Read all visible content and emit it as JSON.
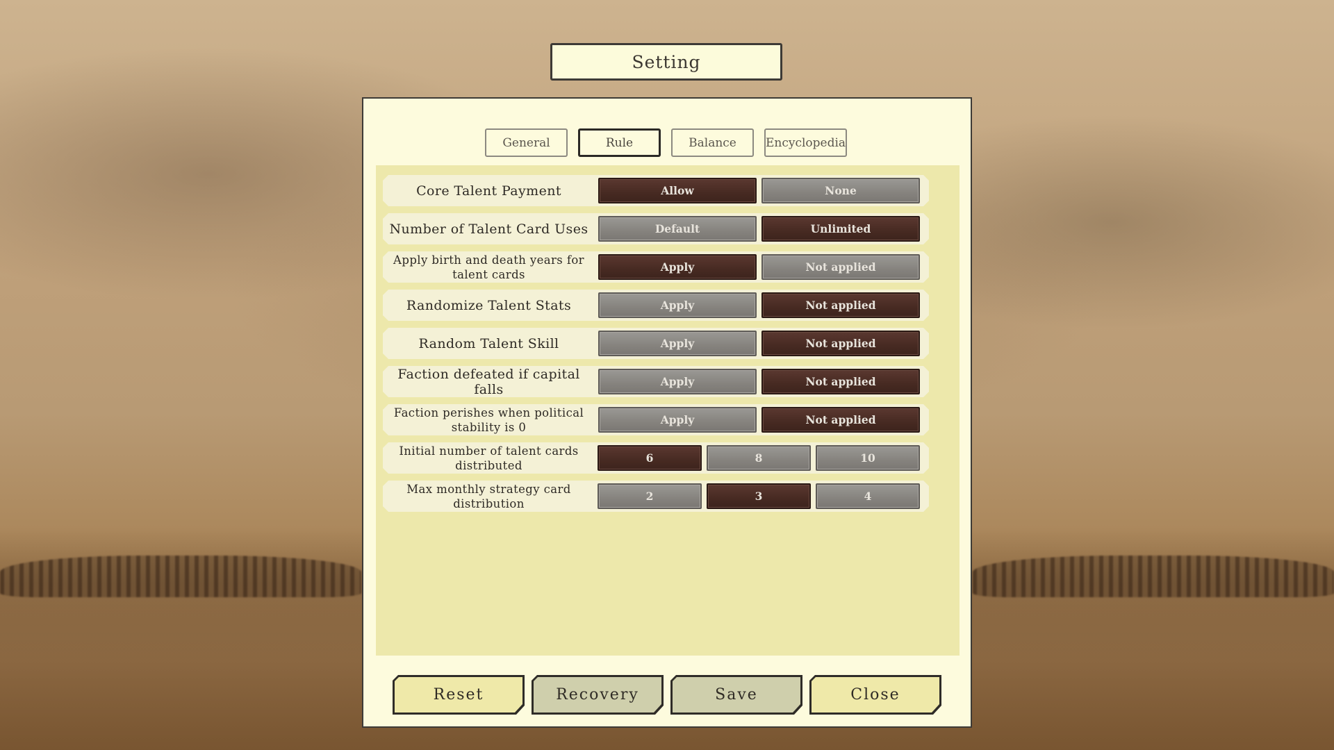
{
  "title": "Setting",
  "tabs": [
    {
      "label": "General",
      "active": false
    },
    {
      "label": "Rule",
      "active": true
    },
    {
      "label": "Balance",
      "active": false
    },
    {
      "label": "Encyclopedia",
      "active": false
    }
  ],
  "rules": [
    {
      "label": "Core Talent Payment",
      "options": [
        "Allow",
        "None"
      ],
      "selected": 0
    },
    {
      "label": "Number of Talent Card Uses",
      "options": [
        "Default",
        "Unlimited"
      ],
      "selected": 1
    },
    {
      "label": "Apply birth and death years for talent cards",
      "options": [
        "Apply",
        "Not applied"
      ],
      "selected": 0
    },
    {
      "label": "Randomize Talent Stats",
      "options": [
        "Apply",
        "Not applied"
      ],
      "selected": 1
    },
    {
      "label": "Random Talent Skill",
      "options": [
        "Apply",
        "Not applied"
      ],
      "selected": 1
    },
    {
      "label": "Faction defeated if capital falls",
      "options": [
        "Apply",
        "Not applied"
      ],
      "selected": 1
    },
    {
      "label": "Faction perishes when political stability is 0",
      "options": [
        "Apply",
        "Not applied"
      ],
      "selected": 1
    },
    {
      "label": "Initial number of talent cards distributed",
      "options": [
        "6",
        "8",
        "10"
      ],
      "selected": 0
    },
    {
      "label": "Max monthly strategy card distribution",
      "options": [
        "2",
        "3",
        "4"
      ],
      "selected": 1
    }
  ],
  "footer": {
    "reset_label": "Reset",
    "recovery_label": "Recovery",
    "save_label": "Save",
    "close_label": "Close"
  },
  "colors": {
    "selected": "#4a2c24",
    "unselected": "#8a8783",
    "panel": "#fdfbdd",
    "content": "#ede8ab"
  }
}
